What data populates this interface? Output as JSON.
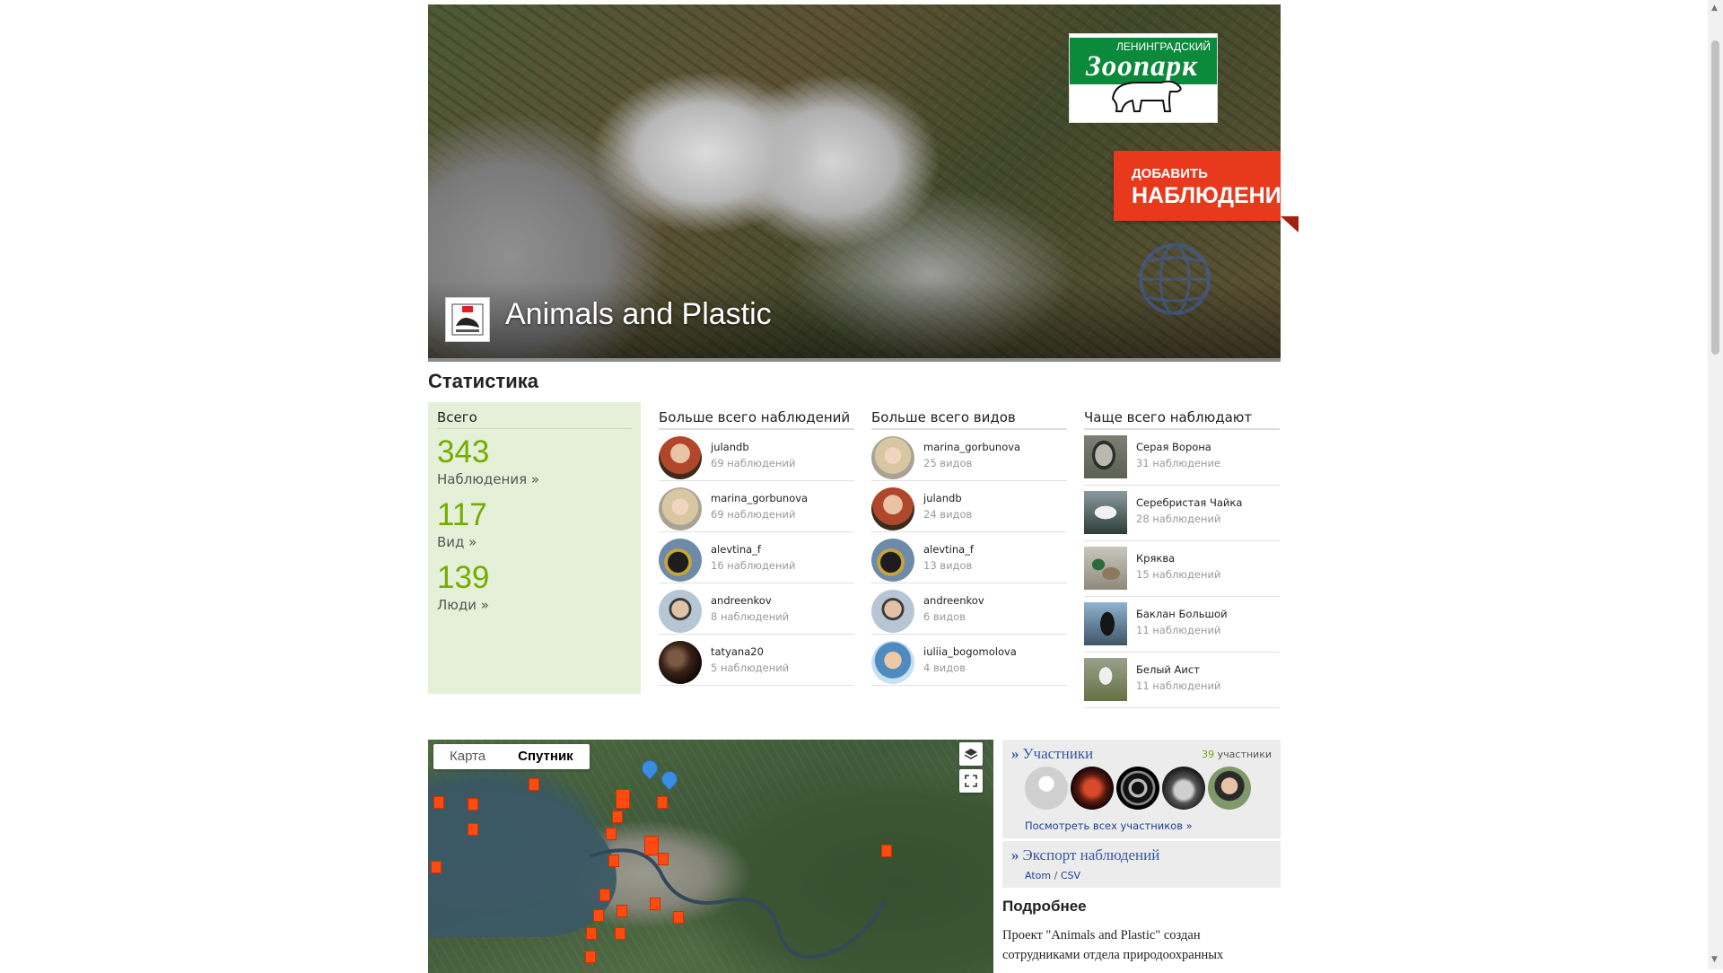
{
  "hero": {
    "project_title": "Animals and Plastic",
    "zoo_logo_top": "ЛЕНИНГРАДСКИЙ",
    "zoo_logo_word": "Зоопарк",
    "add_button_line1": "ДОБАВИТЬ",
    "add_button_line2": "НАБЛЮДЕНИЯ"
  },
  "stats": {
    "title": "Статистика",
    "totals": {
      "header": "Всего",
      "observations_value": "343",
      "observations_label": "Наблюдения »",
      "species_value": "117",
      "species_label": "Вид »",
      "people_value": "139",
      "people_label": "Люди »"
    },
    "most_observations": {
      "header": "Больше всего наблюдений",
      "items": [
        {
          "name": "julandb",
          "count": "69 наблюдений",
          "avatar": "woman-orange"
        },
        {
          "name": "marina_gorbunova",
          "count": "69 наблюдений",
          "avatar": "woman-blonde"
        },
        {
          "name": "alevtina_f",
          "count": "16 наблюдений",
          "avatar": "bird-dark"
        },
        {
          "name": "andreenkov",
          "count": "8 наблюдений",
          "avatar": "man-glasses"
        },
        {
          "name": "tatyana20",
          "count": "5 наблюдений",
          "avatar": "dark-brown"
        }
      ]
    },
    "most_species": {
      "header": "Больше всего видов",
      "items": [
        {
          "name": "marina_gorbunova",
          "count": "25 видов",
          "avatar": "woman-blonde"
        },
        {
          "name": "julandb",
          "count": "24 видов",
          "avatar": "woman-orange"
        },
        {
          "name": "alevtina_f",
          "count": "13 видов",
          "avatar": "bird-dark"
        },
        {
          "name": "andreenkov",
          "count": "6 видов",
          "avatar": "man-glasses"
        },
        {
          "name": "iuliia_bogomolova",
          "count": "4 видов",
          "avatar": "woman-blue"
        }
      ]
    },
    "most_observed": {
      "header": "Чаще всего наблюдают",
      "items": [
        {
          "name": "Серая Ворона",
          "count": "31 наблюдение",
          "color": "#7d7f74"
        },
        {
          "name": "Серебристая Чайка",
          "count": "28 наблюдений",
          "color": "#8b9aa2"
        },
        {
          "name": "Кряква",
          "count": "15 наблюдений",
          "color": "#8f8a7c"
        },
        {
          "name": "Баклан Большой",
          "count": "11 наблюдений",
          "color": "#3f5567"
        },
        {
          "name": "Белый Аист",
          "count": "11 наблюдений",
          "color": "#667044"
        }
      ]
    }
  },
  "map": {
    "tab_map": "Карта",
    "tab_satellite": "Спутник",
    "layers_icon": "layers-icon",
    "fullscreen_icon": "fullscreen-icon"
  },
  "members": {
    "title": "Участники",
    "count_value": "39",
    "count_label": "участники",
    "see_all": "Посмотреть всех участников »"
  },
  "export": {
    "title": "Экспорт наблюдений",
    "atom": "Atom",
    "separator": "/",
    "csv": "CSV"
  },
  "more": {
    "title": "Подробнее",
    "text": "Проект \"Animals and Plastic\" создан сотрудниками отдела природоохранных"
  }
}
